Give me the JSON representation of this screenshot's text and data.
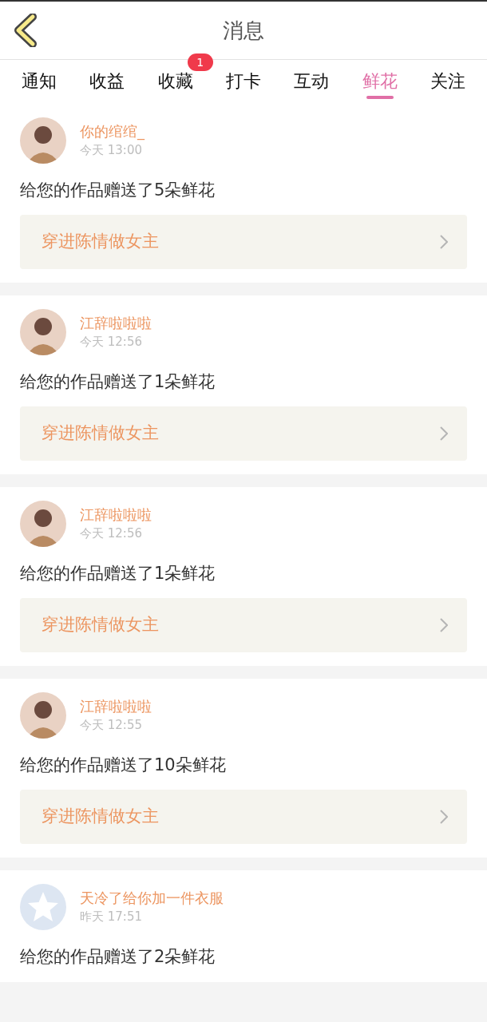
{
  "header": {
    "title": "消息"
  },
  "tabs": [
    {
      "label": "通知",
      "selected": false
    },
    {
      "label": "收益",
      "selected": false
    },
    {
      "label": "收藏",
      "selected": false,
      "badge": "1"
    },
    {
      "label": "打卡",
      "selected": false
    },
    {
      "label": "互动",
      "selected": false
    },
    {
      "label": "鲜花",
      "selected": true
    },
    {
      "label": "关注",
      "selected": false
    }
  ],
  "messages": [
    {
      "default_avatar": false,
      "name": "你的绾绾_",
      "time": "今天 13:00",
      "text": "给您的作品赠送了5朵鲜花",
      "book": "穿进陈情做女主"
    },
    {
      "default_avatar": false,
      "name": "江辞啦啦啦",
      "time": "今天 12:56",
      "text": "给您的作品赠送了1朵鲜花",
      "book": "穿进陈情做女主"
    },
    {
      "default_avatar": false,
      "name": "江辞啦啦啦",
      "time": "今天 12:56",
      "text": "给您的作品赠送了1朵鲜花",
      "book": "穿进陈情做女主"
    },
    {
      "default_avatar": false,
      "name": "江辞啦啦啦",
      "time": "今天 12:55",
      "text": "给您的作品赠送了10朵鲜花",
      "book": "穿进陈情做女主"
    },
    {
      "default_avatar": true,
      "name": "天冷了给你加一件衣服",
      "time": "昨天 17:51",
      "text": "给您的作品赠送了2朵鲜花"
    }
  ]
}
